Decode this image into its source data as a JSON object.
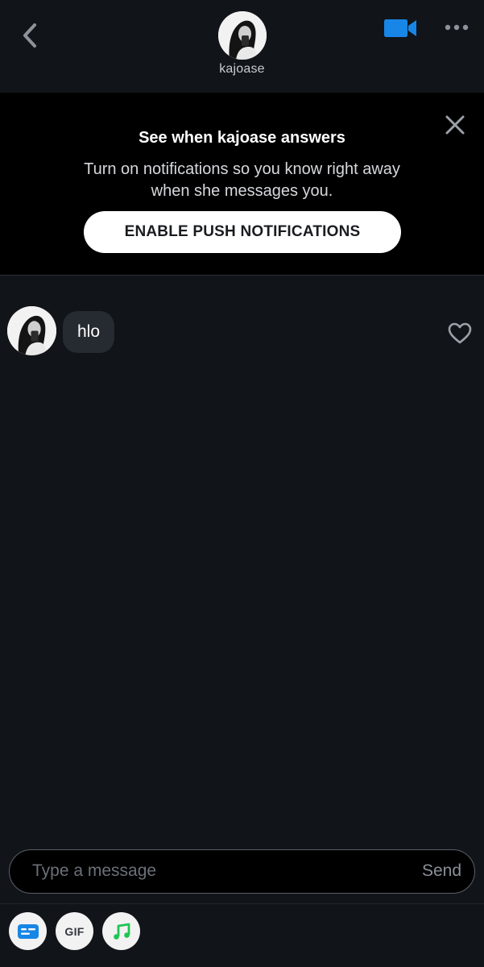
{
  "header": {
    "username": "kajoase"
  },
  "banner": {
    "title": "See when kajoase answers",
    "text": "Turn on notifications so you know right away when she messages you.",
    "button_label": "ENABLE PUSH NOTIFICATIONS"
  },
  "messages": [
    {
      "text": "hlo",
      "sender": "kajoase"
    }
  ],
  "composer": {
    "placeholder": "Type a message",
    "send_label": "Send"
  },
  "toolbar": {
    "gif_label": "GIF"
  },
  "colors": {
    "background": "#111419",
    "banner_background": "#000000",
    "accent_blue": "#1786e6",
    "music_green": "#1fc453",
    "bubble": "#262a31"
  },
  "icons": [
    "back-chevron-icon",
    "video-camera-icon",
    "more-dots-icon",
    "close-icon",
    "heart-icon",
    "sticker-card-icon",
    "gif-icon",
    "music-note-icon"
  ]
}
